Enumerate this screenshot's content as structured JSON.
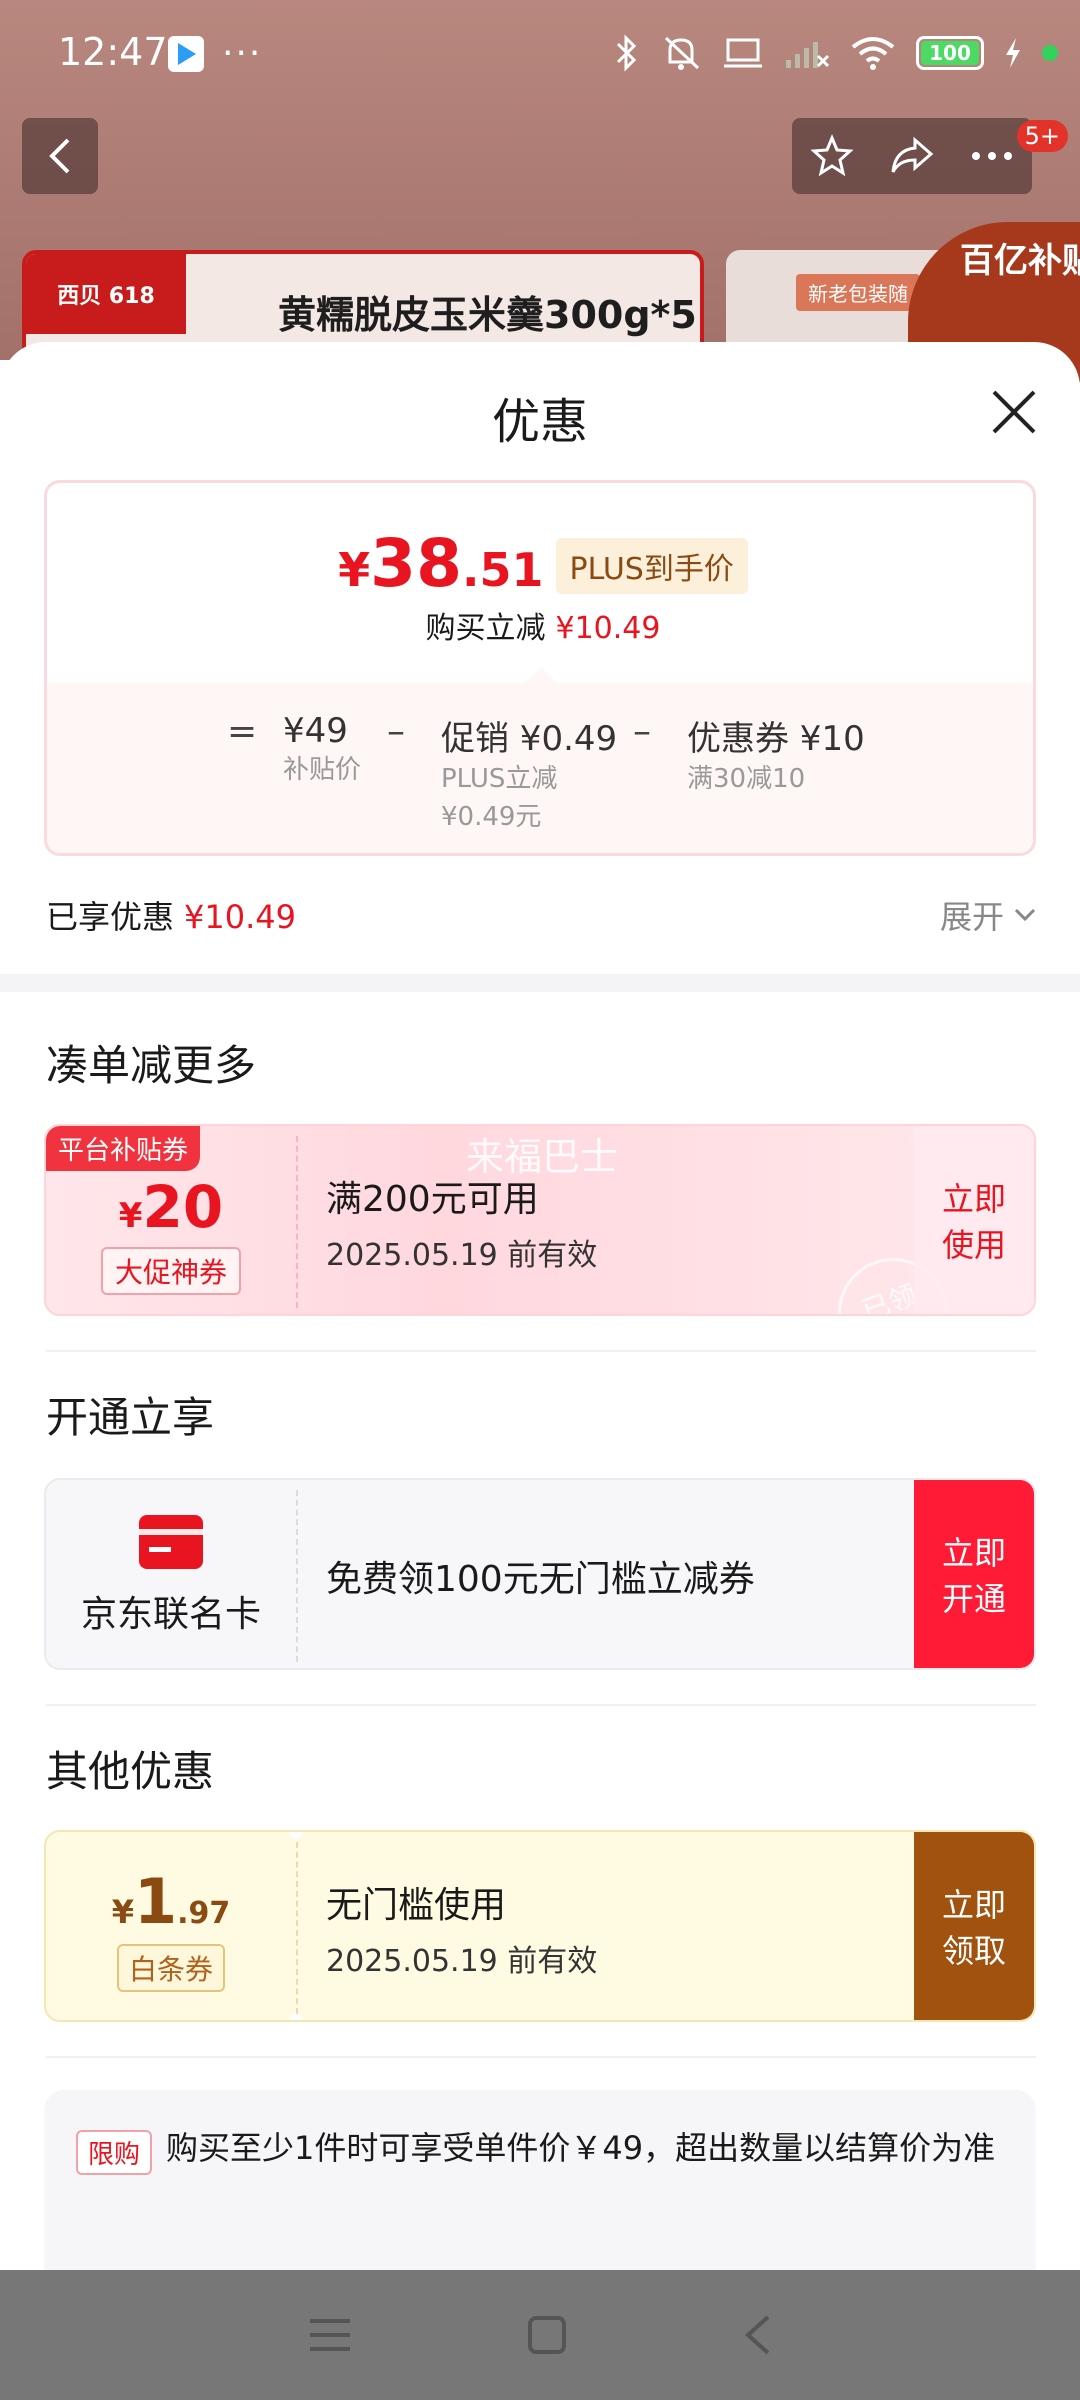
{
  "status_bar": {
    "time": "12:47",
    "battery": "100"
  },
  "nav": {
    "badge": "5+"
  },
  "background": {
    "logo_text": "西贝 618",
    "product_title": "黄糯脱皮玉米羹300g*5",
    "tag": "新老包装随",
    "corner_text": "百亿补贴"
  },
  "sheet": {
    "title": "优惠",
    "price": {
      "yen": "¥",
      "integer": "38",
      "decimal": ".51",
      "plus_tag": "PLUS到手价"
    },
    "instant": {
      "label": "购买立减",
      "value": "¥10.49"
    },
    "breakdown": [
      {
        "op": "=",
        "value": "¥49",
        "sub": "补贴价",
        "sub2": ""
      },
      {
        "op": "–",
        "value": "促销 ¥0.49",
        "sub": "PLUS立减",
        "sub2": "¥0.49元"
      },
      {
        "op": "–",
        "value": "优惠券 ¥10",
        "sub": "满30减10",
        "sub2": ""
      }
    ],
    "enjoyed": {
      "label": "已享优惠",
      "value": "¥10.49",
      "expand": "展开"
    },
    "section_more": "凑单减更多",
    "coupon_platform": {
      "label": "平台补贴券",
      "yen": "¥",
      "amount": "20",
      "chip": "大促神券",
      "watermark": "来福巴士",
      "condition": "满200元可用",
      "validity": "2025.05.19 前有效",
      "action": "立即使用",
      "stamp": "已领"
    },
    "section_open": "开通立享",
    "card_offer": {
      "name": "京东联名卡",
      "desc": "免费领100元无门槛立减券",
      "action": "立即开通"
    },
    "section_other": "其他优惠",
    "coupon_baitiao": {
      "yen": "¥",
      "amount": "1",
      "decimal": ".97",
      "chip": "白条券",
      "condition": "无门槛使用",
      "validity": "2025.05.19 前有效",
      "action": "立即领取"
    },
    "limit": {
      "tag": "限购",
      "text": "购买至少1件时可享受单件价￥49，超出数量以结算价为准"
    }
  },
  "colors": {
    "accent_red": "#e8141f",
    "baitiao_brown": "#a0520e",
    "open_red": "#ff1a35"
  }
}
